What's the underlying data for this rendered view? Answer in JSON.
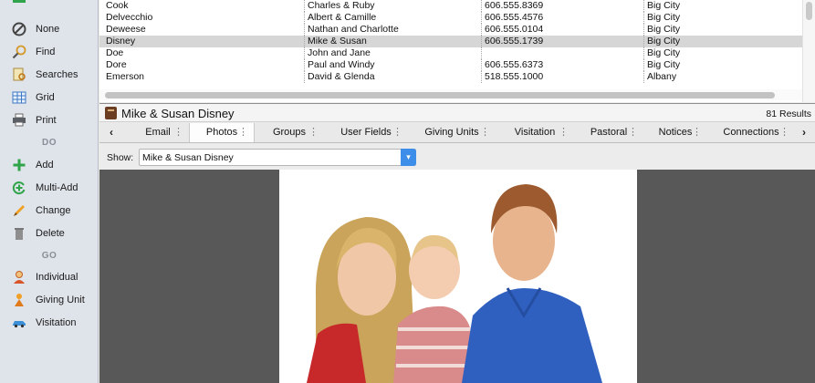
{
  "sidebar": {
    "items": [
      {
        "label": "None",
        "icon": "none-icon"
      },
      {
        "label": "Find",
        "icon": "find-icon"
      },
      {
        "label": "Searches",
        "icon": "searches-icon"
      },
      {
        "label": "Grid",
        "icon": "grid-icon"
      },
      {
        "label": "Print",
        "icon": "print-icon"
      },
      {
        "label": "Add",
        "icon": "add-icon"
      },
      {
        "label": "Multi-Add",
        "icon": "multi-add-icon"
      },
      {
        "label": "Change",
        "icon": "change-icon"
      },
      {
        "label": "Delete",
        "icon": "delete-icon"
      },
      {
        "label": "Individual",
        "icon": "individual-icon"
      },
      {
        "label": "Giving Unit",
        "icon": "giving-unit-icon"
      },
      {
        "label": "Visitation",
        "icon": "visitation-icon"
      }
    ],
    "headers": {
      "do": "DO",
      "go": "GO"
    }
  },
  "table": {
    "rows": [
      {
        "last": "Cook",
        "first": "Charles & Ruby",
        "phone": "606.555.8369",
        "city": "Big City",
        "selected": false
      },
      {
        "last": "Delvecchio",
        "first": "Albert & Camille",
        "phone": "606.555.4576",
        "city": "Big City",
        "selected": false
      },
      {
        "last": "Deweese",
        "first": "Nathan and Charlotte",
        "phone": "606.555.0104",
        "city": "Big City",
        "selected": false
      },
      {
        "last": "Disney",
        "first": "Mike & Susan",
        "phone": "606.555.1739",
        "city": "Big City",
        "selected": true
      },
      {
        "last": "Doe",
        "first": "John and Jane",
        "phone": "",
        "city": "Big City",
        "selected": false
      },
      {
        "last": "Dore",
        "first": "Paul and Windy",
        "phone": "606.555.6373",
        "city": "Big City",
        "selected": false
      },
      {
        "last": "Emerson",
        "first": "David & Glenda",
        "phone": "518.555.1000",
        "city": "Albany",
        "selected": false
      }
    ]
  },
  "record": {
    "title": "Mike & Susan Disney",
    "count": "81 Results"
  },
  "tabs": {
    "items": [
      {
        "label": "Email",
        "active": false
      },
      {
        "label": "Photos",
        "active": true
      },
      {
        "label": "Groups",
        "active": false
      },
      {
        "label": "User Fields",
        "active": false
      },
      {
        "label": "Giving Units",
        "active": false
      },
      {
        "label": "Visitation",
        "active": false
      },
      {
        "label": "Pastoral",
        "active": false
      },
      {
        "label": "Notices",
        "active": false
      },
      {
        "label": "Connections",
        "active": false
      }
    ],
    "prev": "‹",
    "next": "›"
  },
  "show": {
    "label": "Show:",
    "value": "Mike & Susan Disney"
  }
}
